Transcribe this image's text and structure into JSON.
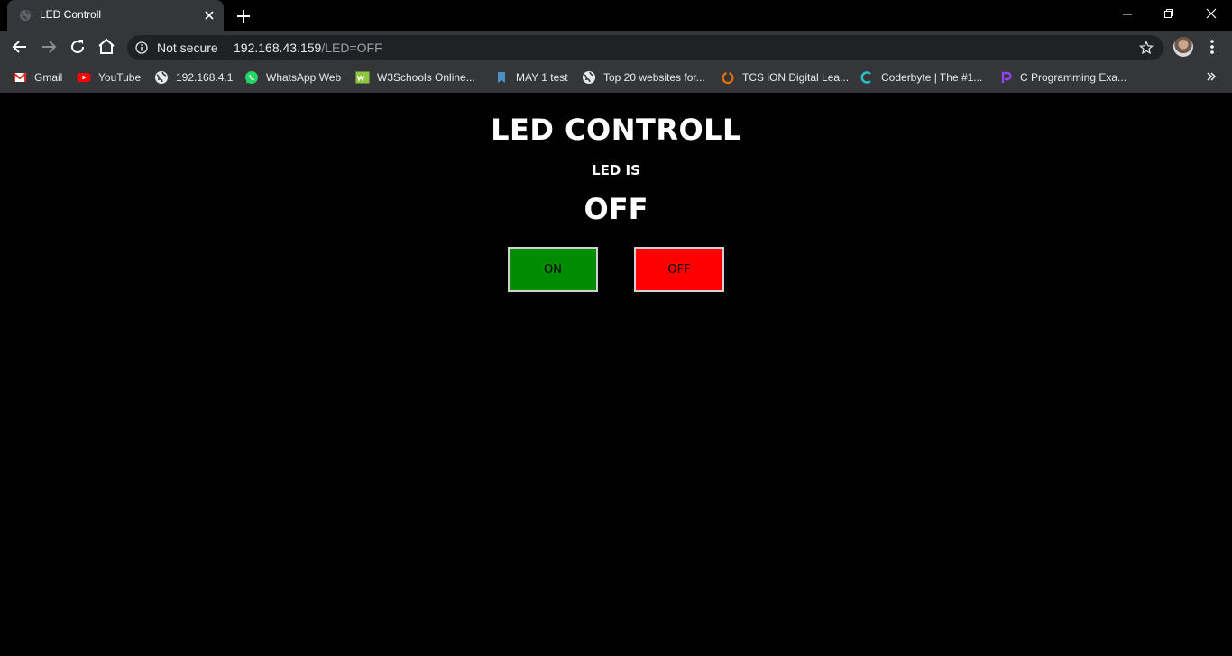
{
  "tab": {
    "title": "LED Controll"
  },
  "omnibox": {
    "security_label": "Not secure",
    "url_host": "192.168.43.159",
    "url_path": "/LED=OFF"
  },
  "bookmarks": [
    {
      "label": "Gmail",
      "icon": "gmail-icon"
    },
    {
      "label": "YouTube",
      "icon": "youtube-icon"
    },
    {
      "label": "192.168.4.1",
      "icon": "globe-icon"
    },
    {
      "label": "WhatsApp Web",
      "icon": "whatsapp-icon"
    },
    {
      "label": "W3Schools Online...",
      "icon": "w3schools-icon"
    },
    {
      "label": "MAY 1 test",
      "icon": "bookmark-icon"
    },
    {
      "label": "Top 20 websites for...",
      "icon": "globe-icon"
    },
    {
      "label": "TCS iON Digital Lea...",
      "icon": "tcs-ion-icon"
    },
    {
      "label": "Coderbyte | The #1...",
      "icon": "coderbyte-icon"
    },
    {
      "label": "C Programming Exa...",
      "icon": "programiz-icon"
    }
  ],
  "page": {
    "heading": "LED CONTROLL",
    "subheading": "LED IS",
    "state": "OFF",
    "on_button": "ON",
    "off_button": "OFF"
  },
  "colors": {
    "on_button": "#008c00",
    "off_button": "#ff0000",
    "page_background": "#000000",
    "chrome_toolbar": "#35363a"
  }
}
